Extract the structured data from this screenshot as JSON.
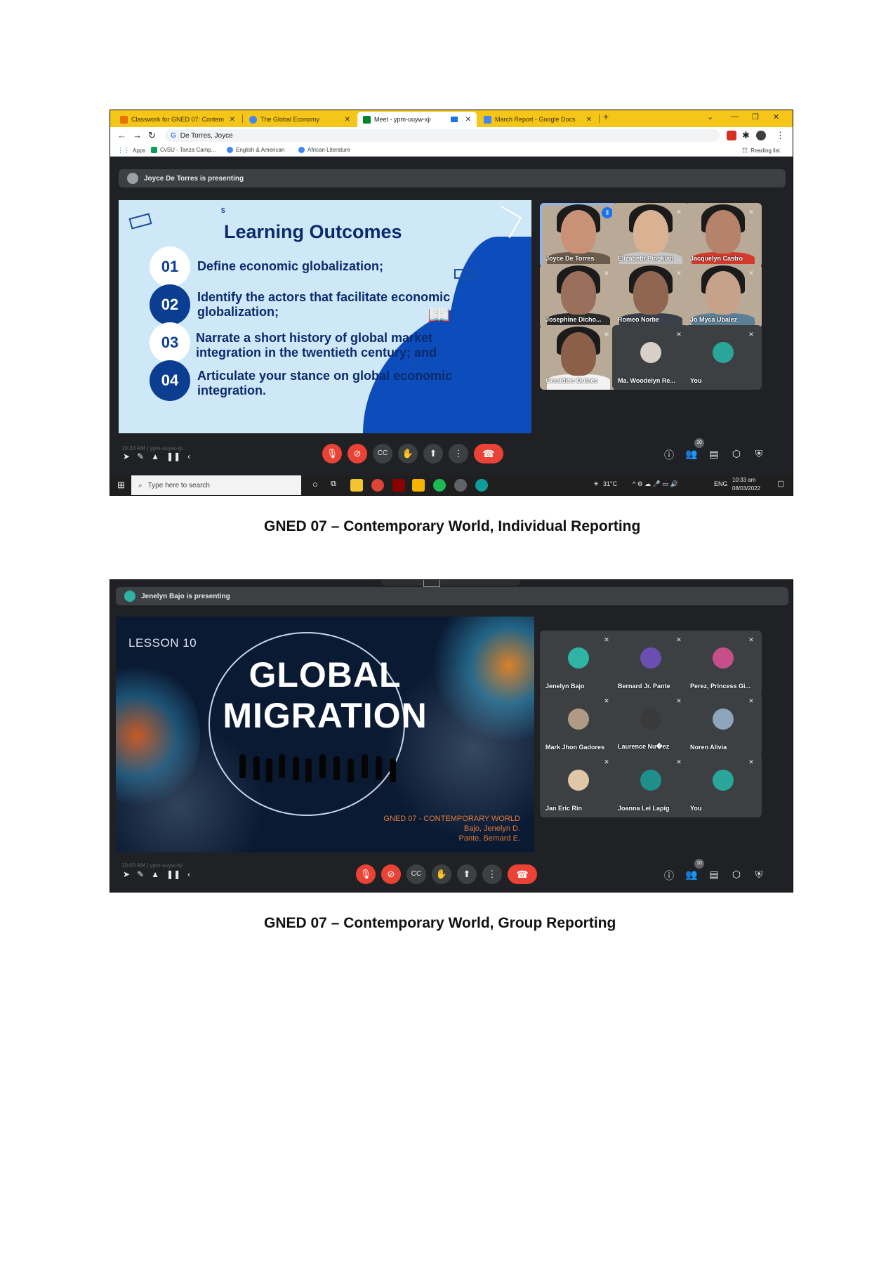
{
  "screenshot1": {
    "tabs": [
      {
        "label": "Classwork for GNED 07: Contem",
        "active": false
      },
      {
        "label": "The Global Economy",
        "active": false
      },
      {
        "label": "Meet - ypm-uuyw-xji",
        "active": true
      },
      {
        "label": "March Report - Google Docs",
        "active": false
      }
    ],
    "new_tab": "+",
    "address": "De Torres, Joyce",
    "bookmarks": [
      "Apps",
      "CvSU - Tanza Camp...",
      "English & American",
      "African Literature"
    ],
    "reading_list": "Reading list",
    "presenting": "Joyce De Torres is presenting",
    "slide": {
      "title": "Learning Outcomes",
      "outcomes": [
        {
          "num": "01",
          "text": "Define economic globalization;"
        },
        {
          "num": "02",
          "text": "Identify the actors that facilitate economic globalization;"
        },
        {
          "num": "03",
          "text": "Narrate a short history of global market integration in the twentieth century; and"
        },
        {
          "num": "04",
          "text": "Articulate your stance on global economic integration."
        }
      ],
      "dollar": "$"
    },
    "participants": [
      {
        "name": "Joyce De Torres",
        "video": true,
        "speaking": true,
        "skin": "#c99276",
        "shirt": "#6b5b4b"
      },
      {
        "name": "Elizabeth Pingkian",
        "video": true,
        "skin": "#d9b294",
        "shirt": "#c7c7c7"
      },
      {
        "name": "Jacquelyn Castro",
        "video": true,
        "skin": "#b5826a",
        "shirt": "#d33a2c"
      },
      {
        "name": "Josephine Dicho...",
        "video": true,
        "skin": "#9a6f5c",
        "shirt": "#2b2b2b"
      },
      {
        "name": "Romeo Norbe",
        "video": true,
        "skin": "#8f6750",
        "shirt": "#3a3f4a"
      },
      {
        "name": "Jo Myca Ubalez",
        "video": true,
        "skin": "#c7a28a",
        "shirt": "#5b7f95"
      },
      {
        "name": "Geraldine Quines",
        "video": true,
        "skin": "#8c5f49",
        "shirt": "#f2f2f2"
      },
      {
        "name": "Ma. Woodelyn Re...",
        "video": false,
        "avatar": "#d8cfc6"
      },
      {
        "name": "You",
        "video": false,
        "avatar": "#2aa59a"
      }
    ],
    "participant_count": "10",
    "time_overlay": "10:33 AM | ypm-uuyw-xji",
    "taskbar": {
      "search_placeholder": "Type here to search",
      "weather": "31°C",
      "lang": "ENG",
      "time": "10:33 am",
      "date": "08/03/2022"
    }
  },
  "caption1": "GNED 07 – Contemporary World, Individual Reporting",
  "screenshot2": {
    "presenting": "Jenelyn Bajo is presenting",
    "slide": {
      "lesson": "LESSON 10",
      "title_line1": "GLOBAL",
      "title_line2": "MIGRATION",
      "course": "GNED 07 - CONTEMPORARY WORLD",
      "author1": "Bajo, Jenelyn D.",
      "author2": "Pante, Bernard E."
    },
    "participants": [
      {
        "name": "Jenelyn Bajo",
        "avatar": "#2fb3a5"
      },
      {
        "name": "Bernard Jr. Pante",
        "avatar": "#6a4fb0"
      },
      {
        "name": "Perez, Princess Gi...",
        "avatar": "#c64f8a"
      },
      {
        "name": "Mark Jhon Gadores",
        "avatar": "#b09a86"
      },
      {
        "name": "Laurence Nu�ez",
        "avatar": "#3a3a3a"
      },
      {
        "name": "Noren Alivia",
        "avatar": "#8fa4bd"
      },
      {
        "name": "Jan Eric Rin",
        "avatar": "#e0c7a8"
      },
      {
        "name": "Joanna Lei Lapig",
        "avatar": "#1e8f8a"
      },
      {
        "name": "You",
        "avatar": "#2aa59a"
      }
    ],
    "participant_count": "10",
    "time_overlay": "10:03 AM | ypm-uuyw-xji"
  },
  "caption2": "GNED 07 – Contemporary World, Group Reporting",
  "colors": {
    "meet_bg": "#202124",
    "tile_bg": "#3c4043",
    "red": "#ea4335",
    "chrome_tabstrip": "#f5c518",
    "slide_navy": "#0b2a6b"
  },
  "icons": [
    "mic-off-icon",
    "camera-off-icon",
    "captions-icon",
    "raise-hand-icon",
    "present-icon",
    "more-icon",
    "end-call-icon",
    "info-icon",
    "people-icon",
    "chat-icon",
    "activities-icon",
    "host-controls-icon"
  ]
}
